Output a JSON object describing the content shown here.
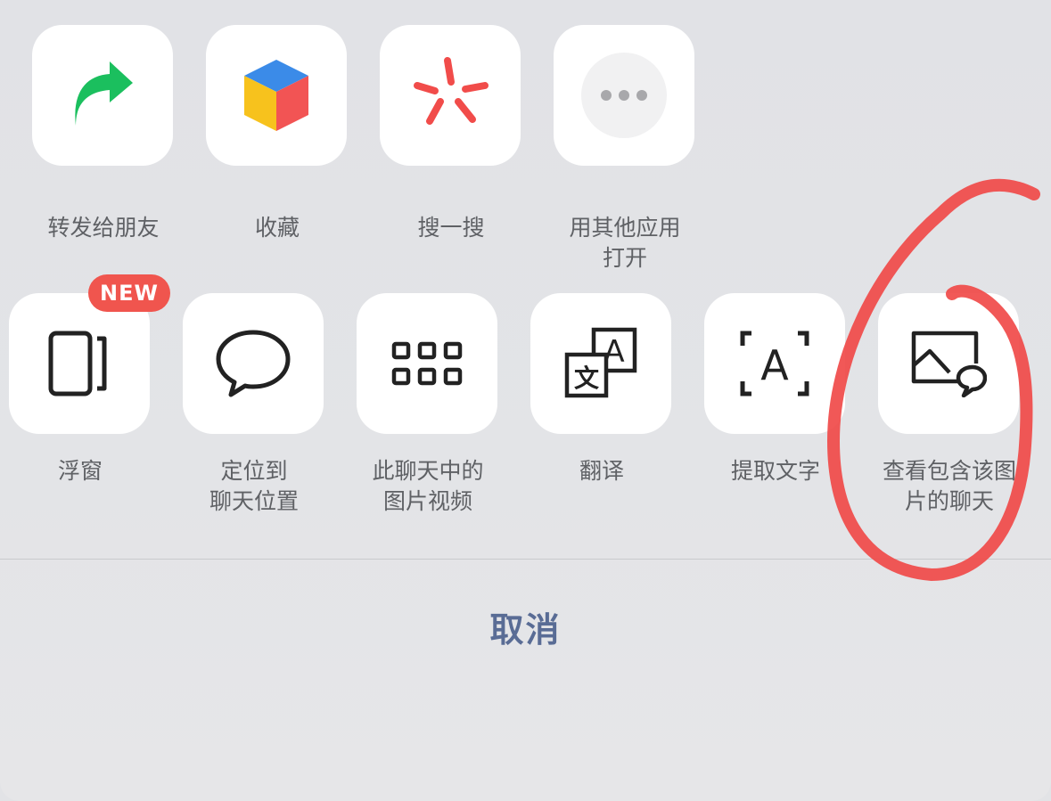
{
  "colors": {
    "background": "#e2e3e6",
    "tile": "#ffffff",
    "label": "#5f6165",
    "cancel": "#596c95",
    "badge": "#f0554e",
    "annotation": "#f04a49"
  },
  "row1": [
    {
      "label": "转发给朋友",
      "icon": "forward-arrow-icon"
    },
    {
      "label": "收藏",
      "icon": "favorites-cube-icon"
    },
    {
      "label": "搜一搜",
      "icon": "search-sparkle-icon"
    },
    {
      "label": "用其他应用\n打开",
      "icon": "more-dots-icon"
    }
  ],
  "row2": [
    {
      "label": "浮窗",
      "icon": "floating-window-icon",
      "badge": "NEW"
    },
    {
      "label": "定位到\n聊天位置",
      "icon": "chat-bubble-icon"
    },
    {
      "label": "此聊天中的\n图片视频",
      "icon": "grid-icon"
    },
    {
      "label": "翻译",
      "icon": "translate-icon",
      "glyph_a": "A",
      "glyph_b": "文"
    },
    {
      "label": "提取文字",
      "icon": "extract-text-icon",
      "glyph": "A"
    },
    {
      "label": "查看包含该图\n片的聊天",
      "icon": "image-chat-icon"
    }
  ],
  "cancel_label": "取消",
  "annotation": "hand-drawn-circle"
}
